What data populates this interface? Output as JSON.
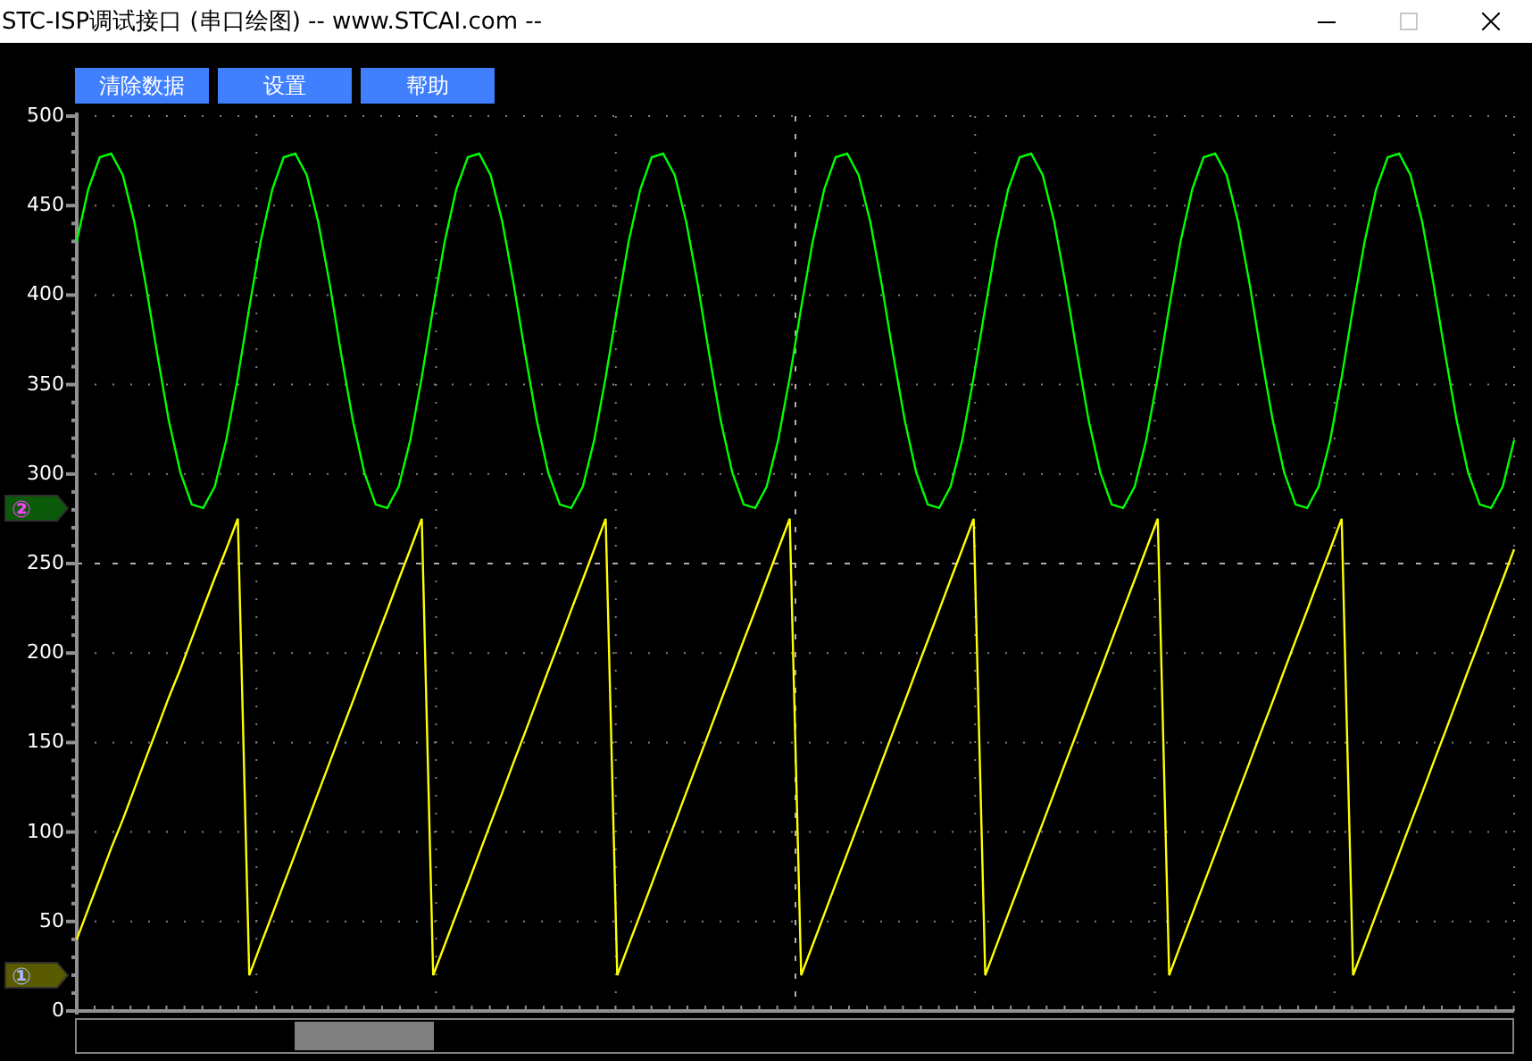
{
  "window": {
    "title": "STC-ISP调试接口 (串口绘图) -- www.STCAI.com --",
    "maximize_disabled": true
  },
  "toolbar": {
    "buttons": [
      "清除数据",
      "设置",
      "帮助"
    ]
  },
  "plot": {
    "chart_data": {
      "type": "line",
      "grid": true,
      "ylim": [
        0,
        500
      ],
      "yticks": [
        0,
        50,
        100,
        150,
        200,
        250,
        300,
        350,
        400,
        450,
        500
      ],
      "series": [
        {
          "color": "#ffff00",
          "values": [
            40,
            57,
            74,
            91,
            107,
            124,
            141,
            158,
            175,
            191,
            208,
            225,
            242,
            258,
            275,
            20,
            37,
            54,
            71,
            88,
            105,
            122,
            139,
            156,
            173,
            190,
            207,
            224,
            241,
            258,
            275,
            20,
            37,
            54,
            71,
            88,
            105,
            122,
            139,
            156,
            173,
            190,
            207,
            224,
            241,
            258,
            275,
            20,
            37,
            54,
            71,
            88,
            105,
            122,
            139,
            156,
            173,
            190,
            207,
            224,
            241,
            258,
            275,
            20,
            37,
            54,
            71,
            88,
            105,
            122,
            139,
            156,
            173,
            190,
            207,
            224,
            241,
            258,
            275,
            20,
            37,
            54,
            71,
            88,
            105,
            122,
            139,
            156,
            173,
            190,
            207,
            224,
            241,
            258,
            275,
            20,
            37,
            54,
            71,
            88,
            105,
            122,
            139,
            156,
            173,
            190,
            207,
            224,
            241,
            258,
            275,
            20,
            37,
            54,
            71,
            88,
            105,
            122,
            139,
            156,
            173,
            190,
            207,
            224,
            241,
            258
          ]
        },
        {
          "color": "#00ff00",
          "values": [
            430,
            459,
            477,
            479,
            467,
            441,
            406,
            367,
            330,
            301,
            283,
            281,
            293,
            319,
            354,
            393,
            430,
            459,
            477,
            479,
            467,
            441,
            406,
            367,
            330,
            301,
            283,
            281,
            293,
            319,
            354,
            393,
            430,
            459,
            477,
            479,
            467,
            441,
            406,
            367,
            330,
            301,
            283,
            281,
            293,
            319,
            354,
            393,
            430,
            459,
            477,
            479,
            467,
            441,
            406,
            367,
            330,
            301,
            283,
            281,
            293,
            319,
            354,
            393,
            430,
            459,
            477,
            479,
            467,
            441,
            406,
            367,
            330,
            301,
            283,
            281,
            293,
            319,
            354,
            393,
            430,
            459,
            477,
            479,
            467,
            441,
            406,
            367,
            330,
            301,
            283,
            281,
            293,
            319,
            354,
            393,
            430,
            459,
            477,
            479,
            467,
            441,
            406,
            367,
            330,
            301,
            283,
            281,
            293,
            319,
            354,
            393,
            430,
            459,
            477,
            479,
            467,
            441,
            406,
            367,
            330,
            301,
            283,
            281,
            293,
            319
          ]
        }
      ]
    },
    "channel_markers": [
      {
        "label": "②",
        "color": "#0a5a0a"
      },
      {
        "label": "①",
        "color": "#5a5a00"
      }
    ]
  }
}
